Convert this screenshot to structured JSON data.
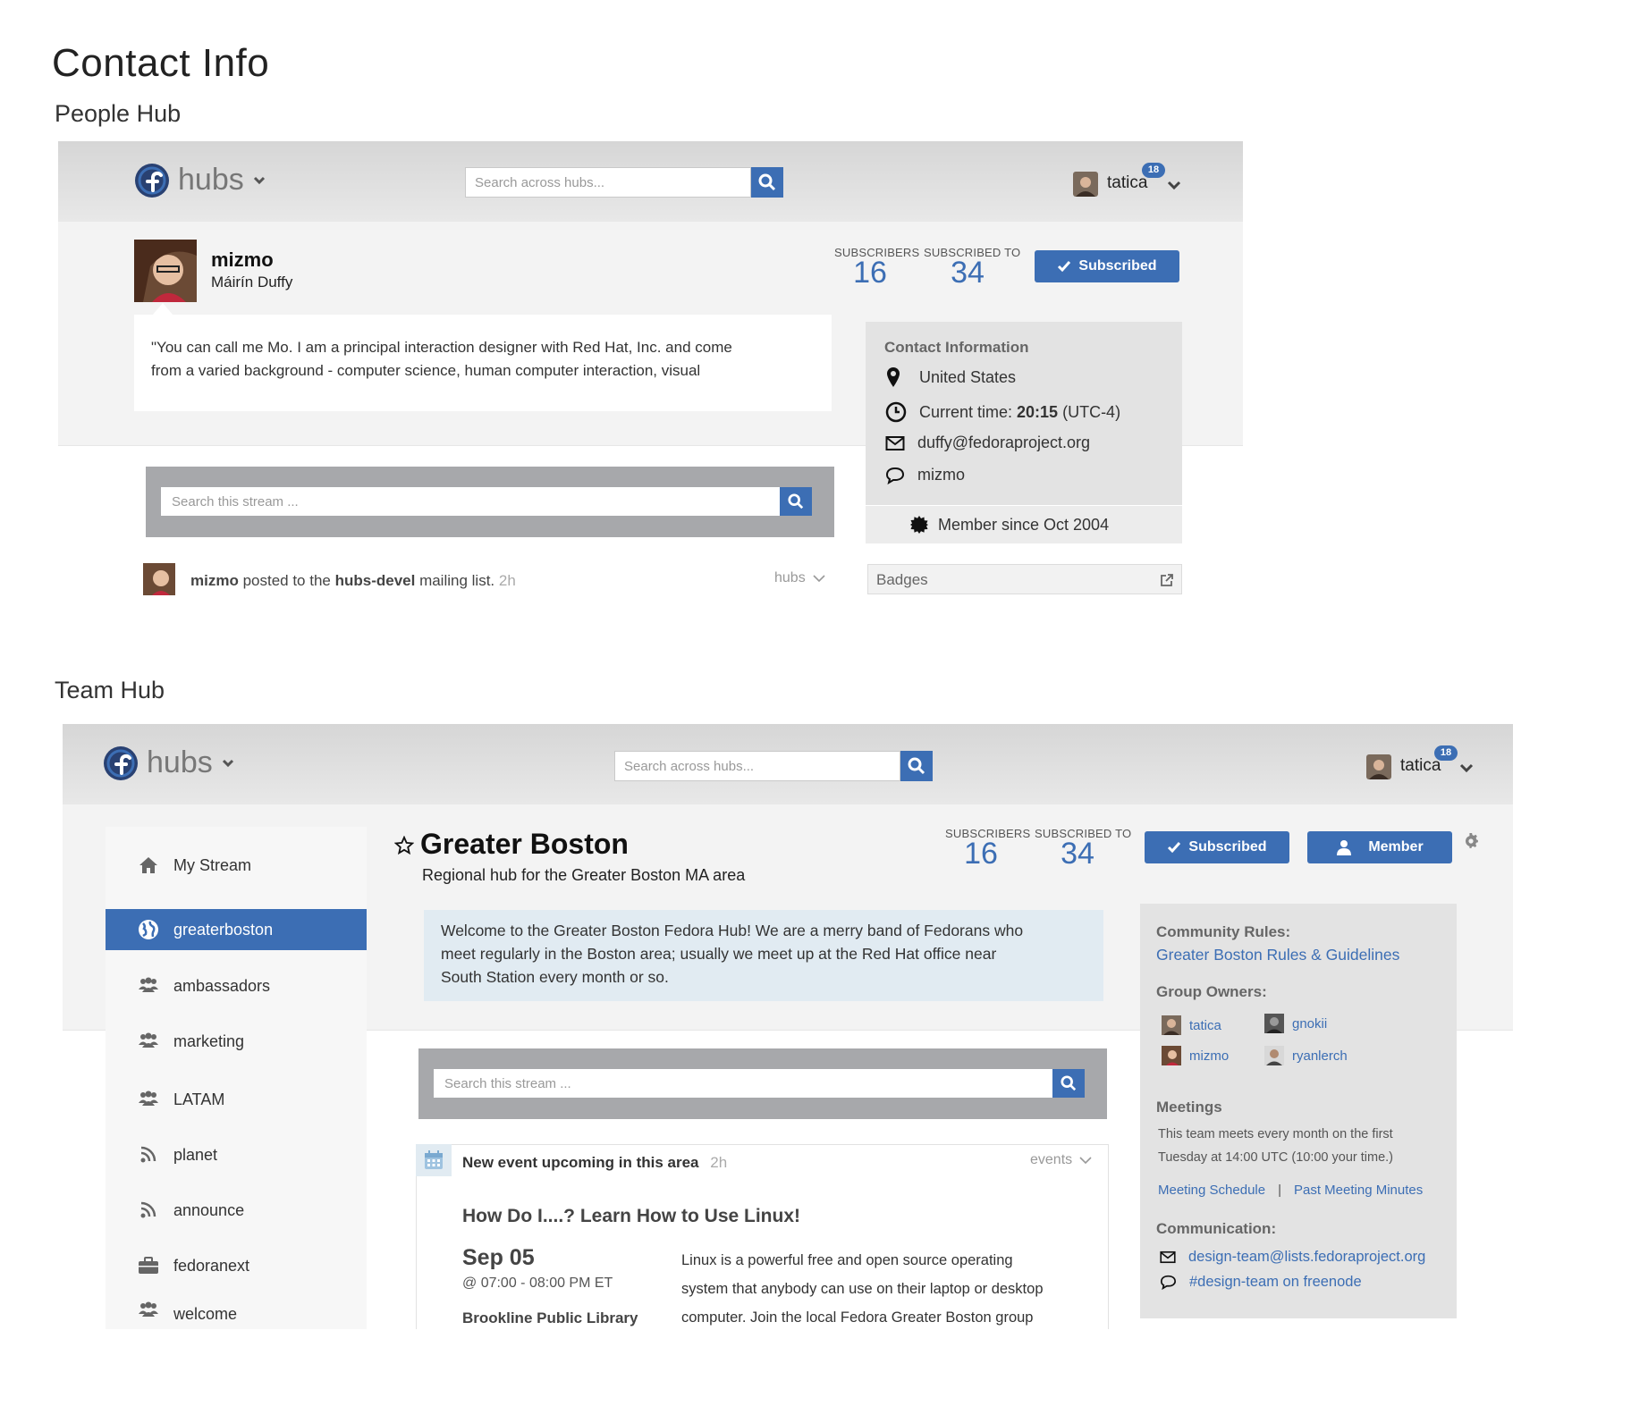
{
  "page": {
    "title": "Contact Info",
    "people_hub_label": "People Hub",
    "team_hub_label": "Team Hub"
  },
  "header": {
    "logo_text": "hubs",
    "search_placeholder": "Search across hubs...",
    "user_name": "tatica",
    "notification_count": "18"
  },
  "people_hub": {
    "username": "mizmo",
    "full_name": "Máirín Duffy",
    "subscribers_label": "SUBSCRIBERS",
    "subscribers_count": "16",
    "subscribed_to_label": "SUBSCRIBED TO",
    "subscribed_to_count": "34",
    "subscribed_button": "Subscribed",
    "bio_line1": "\"You can call me Mo. I am a principal interaction designer with Red Hat, Inc. and come",
    "bio_line2": "from a varied background - computer science, human computer interaction, visual",
    "contact": {
      "heading": "Contact Information",
      "location": "United States",
      "time_label": "Current time: ",
      "time_value": "20:15",
      "time_zone": " (UTC-4)",
      "email": "duffy@fedoraproject.org",
      "irc": "mizmo",
      "member_since": "Member since Oct 2004"
    },
    "stream_search_placeholder": "Search this stream ...",
    "activity": {
      "user": "mizmo",
      "text_mid": " posted to the ",
      "list": "hubs-devel",
      "text_end": " mailing list.",
      "time": " 2h",
      "filter": "hubs"
    },
    "badges_label": "Badges"
  },
  "team_hub": {
    "nav": [
      {
        "label": "My Stream",
        "icon": "home-icon"
      },
      {
        "label": "greaterboston",
        "icon": "globe-icon"
      },
      {
        "label": "ambassadors",
        "icon": "group-icon"
      },
      {
        "label": "marketing",
        "icon": "group-icon"
      },
      {
        "label": "LATAM",
        "icon": "group-icon"
      },
      {
        "label": "planet",
        "icon": "rss-icon"
      },
      {
        "label": "announce",
        "icon": "rss-icon"
      },
      {
        "label": "fedoranext",
        "icon": "briefcase-icon"
      },
      {
        "label": "welcome",
        "icon": "group-icon"
      }
    ],
    "title": "Greater Boston",
    "subtitle": "Regional hub for the Greater Boston MA area",
    "subscribers_label": "SUBSCRIBERS",
    "subscribers_count": "16",
    "subscribed_to_label": "SUBSCRIBED TO",
    "subscribed_to_count": "34",
    "subscribed_button": "Subscribed",
    "member_button": "Member",
    "welcome_line1": "Welcome to the Greater Boston Fedora Hub! We are a merry band of Fedorans who",
    "welcome_line2": "meet regularly in the Boston area; usually we meet up at the Red Hat office near",
    "welcome_line3": "South Station every month or so.",
    "stream_search_placeholder": "Search this stream ...",
    "event": {
      "header": "New event upcoming in this area",
      "time": "2h",
      "filter": "events",
      "title": "How Do I....? Learn How to Use Linux!",
      "date": "Sep 05",
      "hours": "@ 07:00 - 08:00 PM ET",
      "location": "Brookline Public Library",
      "desc_line1": "Linux is a powerful free and open source operating",
      "desc_line2": "system that anybody can use on their laptop or desktop",
      "desc_line3": "computer. Join the local Fedora Greater Boston group"
    },
    "sidebar": {
      "rules_heading": "Community Rules:",
      "rules_link": "Greater Boston Rules & Guidelines",
      "owners_heading": "Group Owners:",
      "owners": [
        "tatica",
        "gnokii",
        "mizmo",
        "ryanlerch"
      ],
      "meetings_heading": "Meetings",
      "meetings_line1": "This team meets every month on the first",
      "meetings_line2": "Tuesday at 14:00 UTC (10:00 your time.)",
      "meeting_schedule": "Meeting Schedule",
      "separator": "|",
      "past_minutes": "Past Meeting Minutes",
      "communication_heading": "Communication:",
      "mailing_list": "design-team@lists.fedoraproject.org",
      "irc_channel": "#design-team on freenode"
    }
  },
  "colors": {
    "accent": "#3c6eb4",
    "stream_bar": "#a7a8ab",
    "panel": "#e3e3e3",
    "welcome_bg": "#e1ebf2"
  }
}
